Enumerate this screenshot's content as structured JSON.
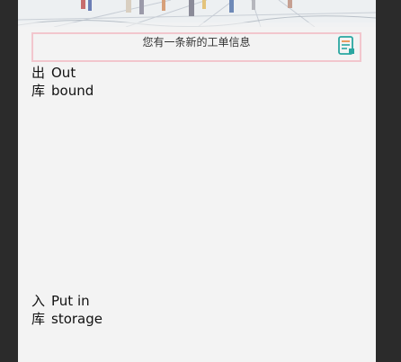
{
  "notice": {
    "text": "您有一条新的工单信息",
    "icon": "document-list-icon",
    "border_color": "#f2c6cd"
  },
  "sections": {
    "outbound": {
      "cn_line1": "出",
      "cn_line2": "库",
      "en_line1": "Out",
      "en_line2": "bound"
    },
    "inbound": {
      "cn_line1": "入",
      "cn_line2": "库",
      "en_line1": "Put in",
      "en_line2": "storage"
    }
  },
  "colors": {
    "page_background": "#f3f3f3",
    "outer_background": "#2b2b2b",
    "icon_teal": "#2aa6a1",
    "icon_orange": "#e7843b"
  }
}
